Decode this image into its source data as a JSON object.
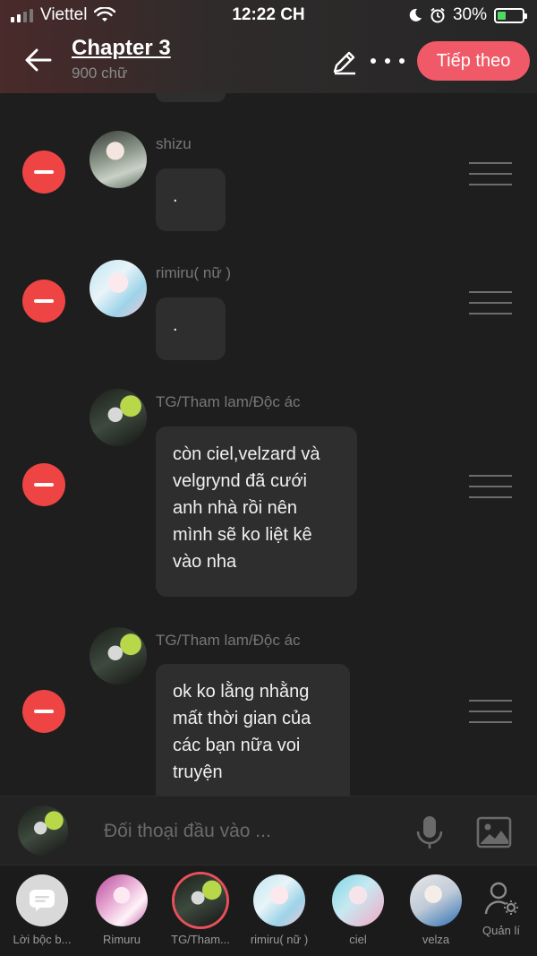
{
  "status": {
    "carrier": "Viettel",
    "time": "12:22 CH",
    "battery": "30%"
  },
  "header": {
    "title": "Chapter 3",
    "word_count": "900 chữ",
    "next_label": "Tiếp theo"
  },
  "messages": [
    {
      "sender": "shizu",
      "text": "."
    },
    {
      "sender": "rimiru( nữ )",
      "text": "."
    },
    {
      "sender": "TG/Tham lam/Độc ác",
      "text": "còn ciel,velzard và velgrynd đã cưới anh nhà rồi nên mình sẽ ko liệt kê vào nha"
    },
    {
      "sender": "TG/Tham lam/Độc ác",
      "text": "ok ko lằng nhằng mất thời gian của các bạn nữa voi truyện"
    }
  ],
  "composer": {
    "placeholder": "Đối thoại đầu vào ..."
  },
  "cast": [
    {
      "label": "Lời bộc b..."
    },
    {
      "label": "Rimuru"
    },
    {
      "label": "TG/Tham..."
    },
    {
      "label": "rimiru( nữ )"
    },
    {
      "label": "ciel"
    },
    {
      "label": "velza"
    }
  ],
  "manage_label": "Quản lí",
  "colors": {
    "accent": "#f05a68",
    "remove": "#ef4444",
    "background": "#1e1e1e",
    "bubble": "#2e2e2e"
  },
  "icons": {
    "back": "back-arrow-icon",
    "edit": "pencil-icon",
    "more": "more-dots-icon",
    "remove": "minus-circle-icon",
    "drag": "drag-handle-icon",
    "mic": "microphone-icon",
    "image": "image-icon",
    "manage": "user-gear-icon"
  }
}
